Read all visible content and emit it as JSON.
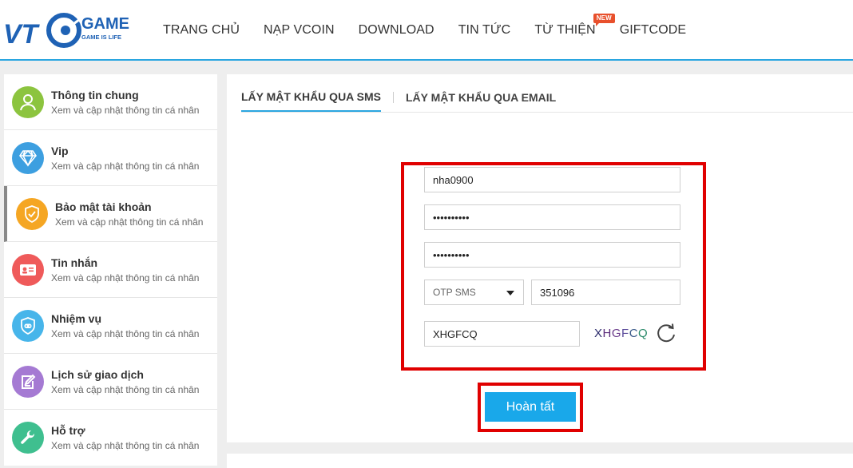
{
  "header": {
    "logo_main": "VTC",
    "logo_brand": "GAME",
    "logo_tagline": "GAME IS LIFE",
    "nav": [
      {
        "label": "TRANG CHỦ"
      },
      {
        "label": "NẠP VCOIN"
      },
      {
        "label": "DOWNLOAD"
      },
      {
        "label": "TIN TỨC"
      },
      {
        "label": "TỪ THIỆN",
        "badge": "NEW"
      },
      {
        "label": "GIFTCODE"
      }
    ]
  },
  "sidebar": {
    "items": [
      {
        "title": "Thông tin chung",
        "subtitle": "Xem và cập nhật thông tin cá nhân",
        "icon": "user-icon",
        "color": "#8cc43f"
      },
      {
        "title": "Vip",
        "subtitle": "Xem và cập nhật thông tin cá nhân",
        "icon": "diamond-icon",
        "color": "#3d9fe0"
      },
      {
        "title": "Bảo mật tài khoản",
        "subtitle": "Xem và cập nhật thông tin cá nhân",
        "icon": "shield-icon",
        "color": "#f5a623"
      },
      {
        "title": "Tin nhắn",
        "subtitle": "Xem và cập nhật thông tin cá nhân",
        "icon": "message-card-icon",
        "color": "#ef5a5a"
      },
      {
        "title": "Nhiệm vụ",
        "subtitle": "Xem và cập nhật thông tin cá nhân",
        "icon": "gamepad-shield-icon",
        "color": "#47b5ea"
      },
      {
        "title": "Lịch sử giao dịch",
        "subtitle": "Xem và cập nhật thông tin cá nhân",
        "icon": "edit-note-icon",
        "color": "#a57ad3"
      },
      {
        "title": "Hỗ trợ",
        "subtitle": "Xem và cập nhật thông tin cá nhân",
        "icon": "wrench-icon",
        "color": "#3fbf8f"
      }
    ]
  },
  "main": {
    "tabs": [
      {
        "label": "LẤY MẬT KHẨU QUA SMS"
      },
      {
        "label": "LẤY MẬT KHẨU QUA EMAIL"
      }
    ],
    "form": {
      "username": "nha0900",
      "password": "••••••••••",
      "password_confirm": "••••••••••",
      "otp_method": "OTP SMS",
      "otp_code": "351096",
      "captcha_input": "XHGFCQ",
      "captcha_image_text": "XHGFCQ"
    },
    "submit_label": "Hoàn tất"
  }
}
